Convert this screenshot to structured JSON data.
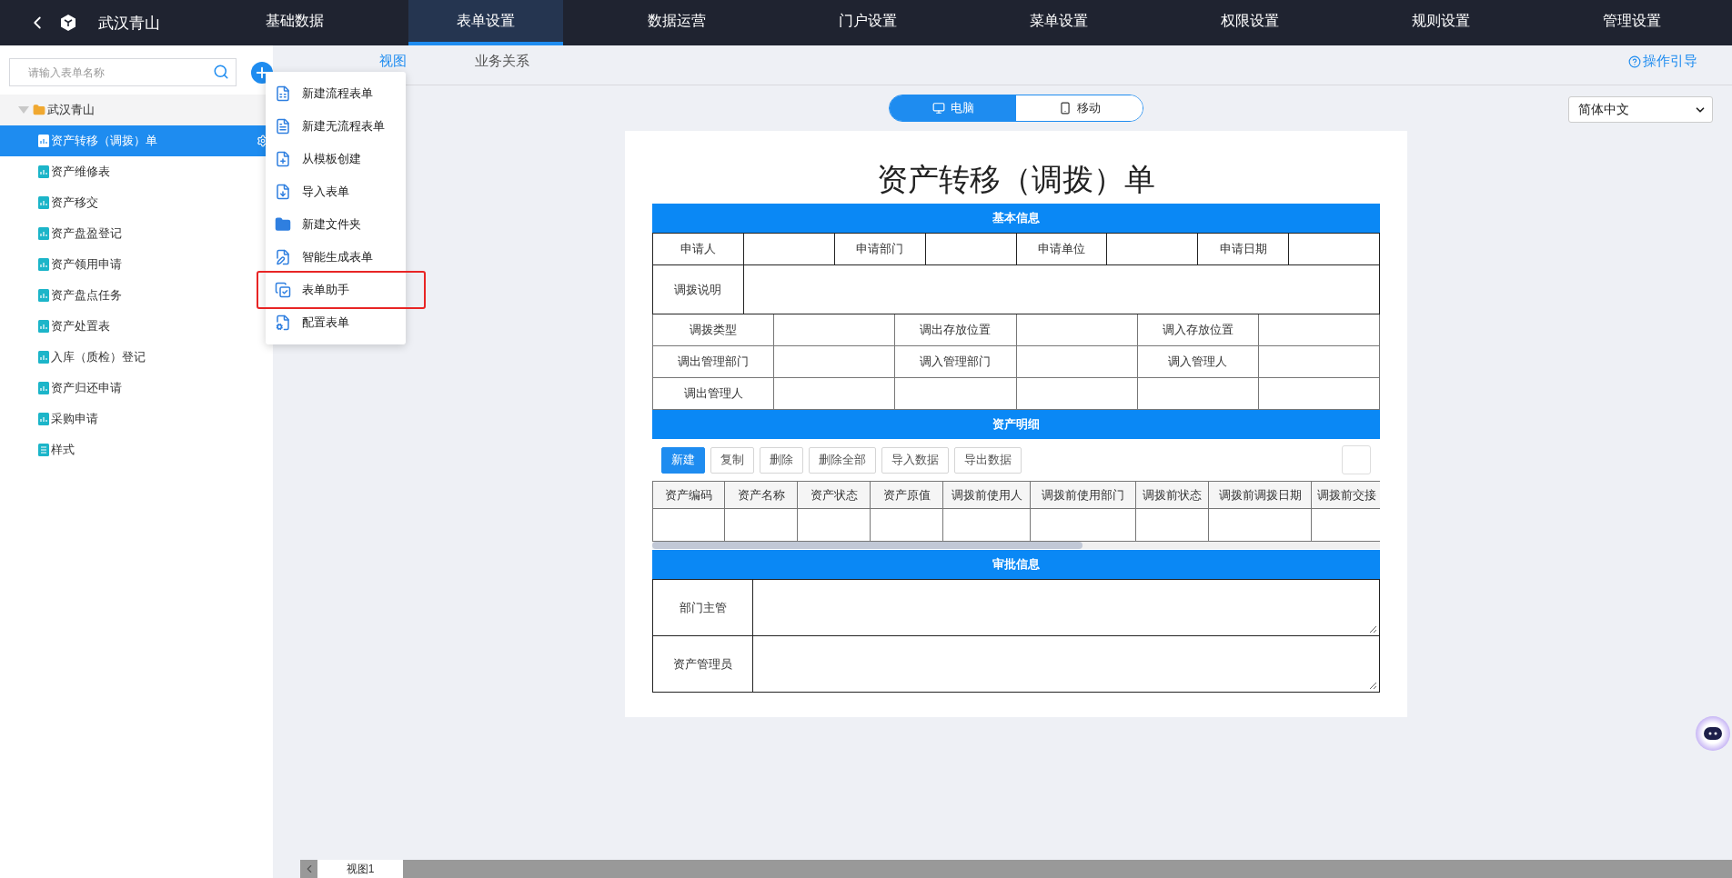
{
  "app": {
    "title": "武汉青山"
  },
  "nav": [
    {
      "label": "基础数据",
      "selected": false
    },
    {
      "label": "表单设置",
      "selected": true
    },
    {
      "label": "数据运营",
      "selected": false
    },
    {
      "label": "门户设置",
      "selected": false
    },
    {
      "label": "菜单设置",
      "selected": false
    },
    {
      "label": "权限设置",
      "selected": false
    },
    {
      "label": "规则设置",
      "selected": false
    },
    {
      "label": "管理设置",
      "selected": false
    }
  ],
  "sidebar": {
    "search": {
      "placeholder": "请输入表单名称"
    },
    "tree": [
      {
        "label": "武汉青山",
        "expanded": true,
        "children": [
          {
            "label": "资产转移（调拨）单",
            "selected": true,
            "kind": "form"
          },
          {
            "label": "资产维修表",
            "selected": false,
            "kind": "form"
          },
          {
            "label": "资产移交",
            "selected": false,
            "kind": "form"
          },
          {
            "label": "资产盘盈登记",
            "selected": false,
            "kind": "form"
          },
          {
            "label": "资产领用申请",
            "selected": false,
            "kind": "form"
          },
          {
            "label": "资产盘点任务",
            "selected": false,
            "kind": "form"
          },
          {
            "label": "资产处置表",
            "selected": false,
            "kind": "form"
          },
          {
            "label": "入库（质检）登记",
            "selected": false,
            "kind": "form"
          },
          {
            "label": "资产归还申请",
            "selected": false,
            "kind": "form"
          },
          {
            "label": "采购申请",
            "selected": false,
            "kind": "form"
          },
          {
            "label": "样式",
            "selected": false,
            "kind": "style"
          }
        ]
      }
    ]
  },
  "menu": {
    "items": [
      {
        "label": "新建流程表单",
        "highlighted": false
      },
      {
        "label": "新建无流程表单",
        "highlighted": false
      },
      {
        "label": "从模板创建",
        "highlighted": false
      },
      {
        "label": "导入表单",
        "highlighted": false
      },
      {
        "label": "新建文件夹",
        "highlighted": false
      },
      {
        "label": "智能生成表单",
        "highlighted": false
      },
      {
        "label": "表单助手",
        "highlighted": true
      },
      {
        "label": "配置表单",
        "highlighted": false
      }
    ]
  },
  "tabs": [
    {
      "label": "视图",
      "selected": true
    },
    {
      "label": "业务关系",
      "selected": false
    }
  ],
  "guide_link": "操作引导",
  "device_toggle": [
    {
      "label": "电脑",
      "selected": true
    },
    {
      "label": "移动",
      "selected": false
    }
  ],
  "language_select": {
    "value": "简体中文"
  },
  "form": {
    "title": "资产转移（调拨）单",
    "basic": {
      "header": "基本信息",
      "first_row": [
        "申请人",
        "申请部门",
        "申请单位",
        "申请日期"
      ],
      "note_label": "调拨说明",
      "grid": [
        [
          "调拨类型",
          "调出存放位置",
          "调入存放位置"
        ],
        [
          "调出管理部门",
          "调入管理部门",
          "调入管理人"
        ],
        [
          "调出管理人"
        ]
      ]
    },
    "detail": {
      "header": "资产明细",
      "buttons": [
        {
          "label": "新建",
          "primary": true
        },
        {
          "label": "复制",
          "primary": false
        },
        {
          "label": "删除",
          "primary": false
        },
        {
          "label": "删除全部",
          "primary": false
        },
        {
          "label": "导入数据",
          "primary": false
        },
        {
          "label": "导出数据",
          "primary": false
        }
      ],
      "columns": [
        "资产编码",
        "资产名称",
        "资产状态",
        "资产原值",
        "调拨前使用人",
        "调拨前使用部门",
        "调拨前状态",
        "调拨前调拨日期",
        "调拨前交接"
      ]
    },
    "approval": {
      "header": "审批信息",
      "rows": [
        "部门主管",
        "资产管理员"
      ]
    }
  },
  "bottom_tabs": [
    {
      "label": "视图1",
      "selected": true
    }
  ]
}
